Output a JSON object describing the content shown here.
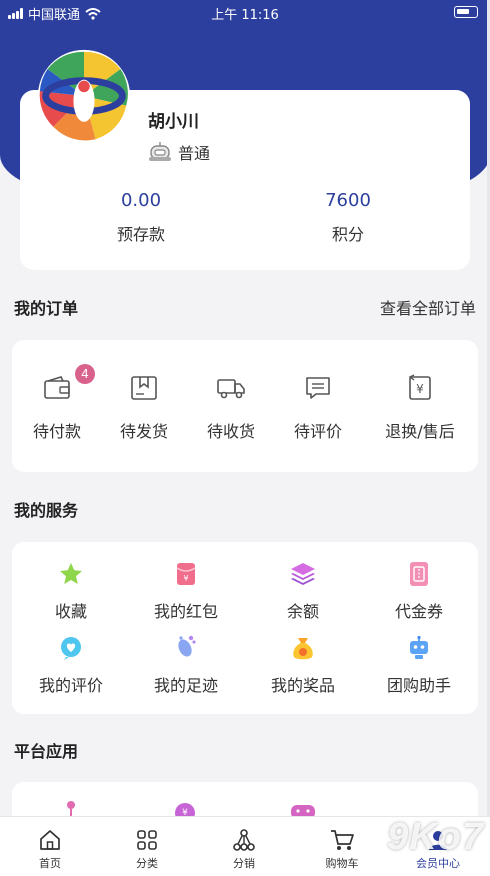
{
  "status_bar": {
    "carrier": "中国联通",
    "time": "上午 11:16"
  },
  "user": {
    "name": "胡小川",
    "level": "普通"
  },
  "stats": [
    {
      "value": "0.00",
      "label": "预存款"
    },
    {
      "value": "7600",
      "label": "积分"
    }
  ],
  "orders": {
    "title": "我的订单",
    "view_all": "查看全部订单",
    "items": [
      {
        "label": "待付款",
        "icon": "wallet-icon",
        "badge": "4"
      },
      {
        "label": "待发货",
        "icon": "box-icon"
      },
      {
        "label": "待收货",
        "icon": "truck-icon"
      },
      {
        "label": "待评价",
        "icon": "comment-icon"
      },
      {
        "label": "退换/售后",
        "icon": "refund-icon"
      }
    ]
  },
  "services": {
    "title": "我的服务",
    "items": [
      {
        "label": "收藏",
        "icon": "star-icon"
      },
      {
        "label": "我的红包",
        "icon": "red-envelope-icon"
      },
      {
        "label": "余额",
        "icon": "layers-icon"
      },
      {
        "label": "代金券",
        "icon": "voucher-icon"
      },
      {
        "label": "我的评价",
        "icon": "review-heart-icon"
      },
      {
        "label": "我的足迹",
        "icon": "footprint-icon"
      },
      {
        "label": "我的奖品",
        "icon": "prize-bag-icon"
      },
      {
        "label": "团购助手",
        "icon": "robot-icon"
      }
    ]
  },
  "platform": {
    "title": "平台应用"
  },
  "tabbar": [
    {
      "label": "首页",
      "icon": "home-icon"
    },
    {
      "label": "分类",
      "icon": "grid-icon"
    },
    {
      "label": "分销",
      "icon": "share-tree-icon"
    },
    {
      "label": "购物车",
      "icon": "cart-icon"
    },
    {
      "label": "会员中心",
      "icon": "member-icon"
    }
  ],
  "watermark": "9Ko7",
  "colors": {
    "header": "#2d3f9e",
    "accent": "#2d3f9e",
    "badge": "#d9628c"
  }
}
